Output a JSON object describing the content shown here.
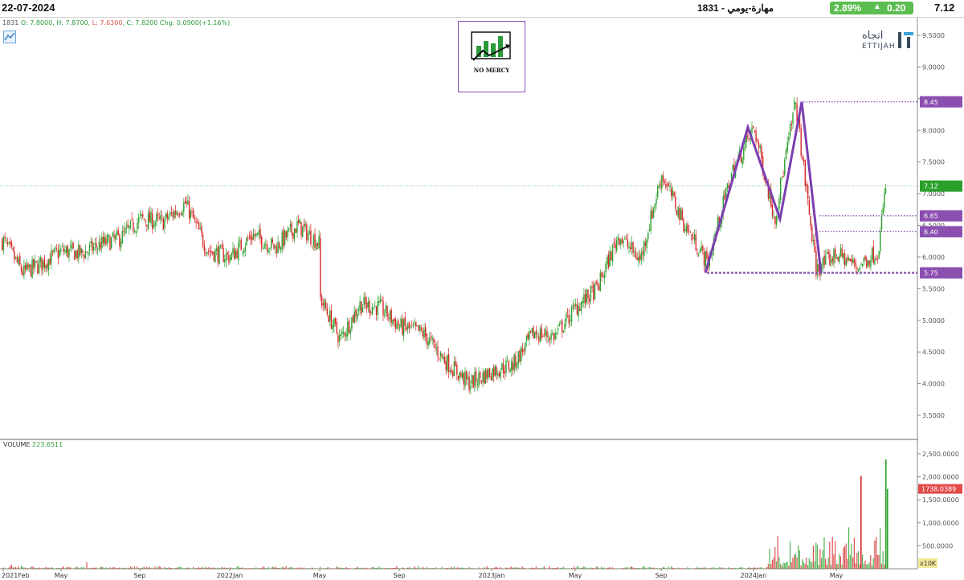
{
  "header": {
    "date": "22-07-2024",
    "title": "مهارة-يومي - 1831",
    "change_pct": "2.89%",
    "change_abs": "0.20",
    "last_price": "7.12",
    "up_color": "#5bbd4f"
  },
  "ohlc_legend": {
    "symbol": "1831",
    "open": "O: 7.8000",
    "high": "H: 7.8700",
    "low": "L: 7.6300",
    "close": "C: 7.8200",
    "chg": "Chg: 0.0900(+1.16%)"
  },
  "logo": {
    "text": "NO MERCY",
    "icon": "bar-chart-arrow-icon"
  },
  "brand": {
    "arabic": "اتجاه",
    "english": "ETTIJAH"
  },
  "volume_legend": {
    "label": "VOLUME",
    "value": "223.6511"
  },
  "chart_data": [
    {
      "type": "candlestick",
      "title": "مهارة-يومي - 1831",
      "x_tick_labels": [
        "2021Feb",
        "May",
        "Sep",
        "2022Jan",
        "May",
        "Sep",
        "2023Jan",
        "May",
        "Sep",
        "2024Jan",
        "May"
      ],
      "x_tick_dates": [
        "2021-02",
        "2021-05",
        "2021-09",
        "2022-01",
        "2022-05",
        "2022-09",
        "2023-01",
        "2023-05",
        "2023-09",
        "2024-01",
        "2024-05"
      ],
      "y_ticks": [
        "9.5000",
        "9.0000",
        "8.5000",
        "8.0000",
        "7.5000",
        "7.0000",
        "6.5000",
        "6.0000",
        "5.5000",
        "5.0000",
        "4.5000",
        "4.0000",
        "3.5000"
      ],
      "ylim": [
        3.25,
        9.6
      ],
      "grid": false,
      "up_color": "#2ca02c",
      "down_color": "#d62728",
      "price_path": [
        [
          "2021-02",
          6.25
        ],
        [
          "2021-03",
          5.75
        ],
        [
          "2021-04",
          5.9
        ],
        [
          "2021-05",
          6.1
        ],
        [
          "2021-06",
          6.05
        ],
        [
          "2021-07",
          6.2
        ],
        [
          "2021-08",
          6.3
        ],
        [
          "2021-09",
          6.6
        ],
        [
          "2021-10",
          6.55
        ],
        [
          "2021-11",
          6.85
        ],
        [
          "2021-12",
          6.1
        ],
        [
          "2022-01",
          6.0
        ],
        [
          "2022-02",
          6.35
        ],
        [
          "2022-03",
          6.15
        ],
        [
          "2022-04",
          6.5
        ],
        [
          "2022-05",
          6.2
        ],
        [
          "2022-05",
          5.35
        ],
        [
          "2022-06",
          4.7
        ],
        [
          "2022-07",
          5.25
        ],
        [
          "2022-08",
          5.2
        ],
        [
          "2022-09",
          4.9
        ],
        [
          "2022-10",
          4.8
        ],
        [
          "2022-11",
          4.35
        ],
        [
          "2022-12",
          4.0
        ],
        [
          "2023-01",
          4.2
        ],
        [
          "2023-02",
          4.3
        ],
        [
          "2023-03",
          4.8
        ],
        [
          "2023-04",
          4.75
        ],
        [
          "2023-05",
          5.2
        ],
        [
          "2023-06",
          5.5
        ],
        [
          "2023-07",
          6.35
        ],
        [
          "2023-08",
          5.95
        ],
        [
          "2023-09",
          7.3
        ],
        [
          "2023-10",
          6.5
        ],
        [
          "2023-11",
          5.9
        ],
        [
          "2023-12",
          7.3
        ],
        [
          "2024-01",
          8.05
        ],
        [
          "2024-02",
          6.6
        ],
        [
          "2024-03",
          8.45
        ],
        [
          "2024-04",
          5.8
        ],
        [
          "2024-05",
          6.05
        ],
        [
          "2024-06",
          5.85
        ],
        [
          "2024-07",
          6.1
        ],
        [
          "2024-07",
          7.12
        ]
      ],
      "last_price": "7.12",
      "last_price_color": "#2ca02c",
      "levels": [
        {
          "label": "8.45",
          "value": 8.45,
          "color": "#8b4fb0"
        },
        {
          "label": "6.65",
          "value": 6.65,
          "color": "#8b4fb0"
        },
        {
          "label": "6.40",
          "value": 6.4,
          "color": "#8b4fb0"
        },
        {
          "label": "5.75",
          "value": 5.75,
          "color": "#8b4fb0"
        }
      ],
      "pattern_points": [
        [
          "2023-11",
          5.75
        ],
        [
          "2024-01",
          8.05
        ],
        [
          "2024-02",
          6.6
        ],
        [
          "2024-03",
          8.45
        ],
        [
          "2024-04",
          5.75
        ]
      ],
      "pattern_color": "#7b3fb0"
    },
    {
      "type": "bar",
      "title": "VOLUME",
      "y_ticks": [
        "2,500.0000",
        "2,000.0000",
        "1,500.0000",
        "1,000.0000",
        "500.0000"
      ],
      "ylim": [
        0,
        2650
      ],
      "units": "x10K",
      "last_label": "1738.0389",
      "spikes": [
        {
          "date": "2024-06",
          "value": 2020
        },
        {
          "date": "2024-07",
          "value": 2380
        },
        {
          "date": "2024-07",
          "value": 1738
        }
      ]
    }
  ]
}
